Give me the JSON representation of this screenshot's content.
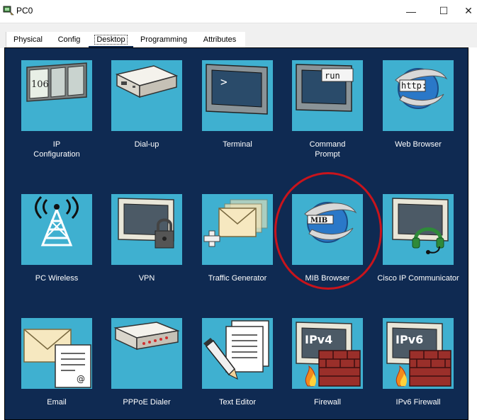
{
  "window": {
    "title": "PC0",
    "icon": "packet-tracer-pc-icon",
    "controls": {
      "minimize": "—",
      "maximize": "☐",
      "close": "✕"
    }
  },
  "tabs": [
    {
      "label": "Physical",
      "active": false
    },
    {
      "label": "Config",
      "active": false
    },
    {
      "label": "Desktop",
      "active": true
    },
    {
      "label": "Programming",
      "active": false
    },
    {
      "label": "Attributes",
      "active": false
    }
  ],
  "apps": [
    {
      "label": "IP\nConfiguration",
      "icon": "ip-config-icon",
      "icon_text": "106"
    },
    {
      "label": "Dial-up",
      "icon": "modem-icon"
    },
    {
      "label": "Terminal",
      "icon": "terminal-icon",
      "icon_text": ">"
    },
    {
      "label": "Command\nPrompt",
      "icon": "command-prompt-icon",
      "icon_text": "run"
    },
    {
      "label": "Web Browser",
      "icon": "web-browser-icon",
      "icon_text": "http:"
    },
    {
      "label": "PC Wireless",
      "icon": "wireless-antenna-icon"
    },
    {
      "label": "VPN",
      "icon": "vpn-lock-icon"
    },
    {
      "label": "Traffic Generator",
      "icon": "traffic-generator-icon"
    },
    {
      "label": "MIB Browser",
      "icon": "mib-browser-icon",
      "icon_text": "MIB"
    },
    {
      "label": "Cisco IP Communicator",
      "icon": "ip-communicator-icon"
    },
    {
      "label": "Email",
      "icon": "email-icon"
    },
    {
      "label": "PPPoE Dialer",
      "icon": "pppoe-dialer-icon"
    },
    {
      "label": "Text Editor",
      "icon": "text-editor-icon"
    },
    {
      "label": "Firewall",
      "icon": "firewall-icon",
      "icon_text": "IPv4"
    },
    {
      "label": "IPv6 Firewall",
      "icon": "ipv6-firewall-icon",
      "icon_text": "IPv6"
    }
  ],
  "colors": {
    "desktop_bg": "#0f2a52",
    "tile_bg": "#3fb0d0",
    "highlight": "#c8141c"
  }
}
